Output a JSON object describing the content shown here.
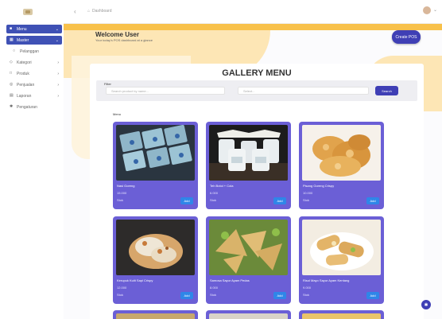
{
  "header": {
    "breadcrumb": "Dashboard"
  },
  "sidebar": {
    "items": [
      {
        "label": "Menu",
        "active": true,
        "icon": "home-icon"
      },
      {
        "label": "Master",
        "active": true,
        "icon": "grid-icon"
      },
      {
        "label": "Pelanggan",
        "active": false,
        "icon": "user-icon"
      },
      {
        "label": "Kategori",
        "active": false,
        "icon": "tag-icon"
      },
      {
        "label": "Produk",
        "active": false,
        "icon": "box-icon"
      },
      {
        "label": "Penjualan",
        "active": false,
        "icon": "cart-icon"
      },
      {
        "label": "Laporan",
        "active": false,
        "icon": "chart-icon"
      },
      {
        "label": "Pengaturan",
        "active": false,
        "icon": "gear-icon"
      }
    ]
  },
  "main": {
    "welcome": "Welcome User",
    "welcome_sub": "Your today's POS dashboard at a glance",
    "header_button": "Create POS",
    "gallery_title": "GALLERY MENU",
    "filter_label": "Filter",
    "search_placeholder": "Search product by name...",
    "category_placeholder": "Select...",
    "filter_button": "Search",
    "section_label": "Menu"
  },
  "cards": [
    {
      "name": "Nasi Goreng",
      "price": "15.000",
      "stock": "Stok",
      "button": "Add",
      "image": "rice-boxes"
    },
    {
      "name": "Teh Botol + Cola",
      "price": "6.000",
      "stock": "Stok",
      "button": "Add",
      "image": "jars"
    },
    {
      "name": "Pisang Goreng Crispy",
      "price": "10.000",
      "stock": "Stok",
      "button": "Add",
      "image": "fried-fritters"
    },
    {
      "name": "Kerupuk Kulit Sapi Crispy",
      "price": "12.000",
      "stock": "Stok",
      "button": "Add",
      "image": "crispy-pastry"
    },
    {
      "name": "Samosa Sayur Ayam Pedas",
      "price": "8.000",
      "stock": "Stok",
      "button": "Add",
      "image": "samosa"
    },
    {
      "name": "Risol Mayo Sayur Ayam Kentang",
      "price": "9.000",
      "stock": "Stok",
      "button": "Add",
      "image": "risoles"
    }
  ],
  "colors": {
    "accent": "#3f3fb5",
    "card": "#6b5fd6",
    "banner": "#f8c14b",
    "add_button": "#2f86e8"
  }
}
